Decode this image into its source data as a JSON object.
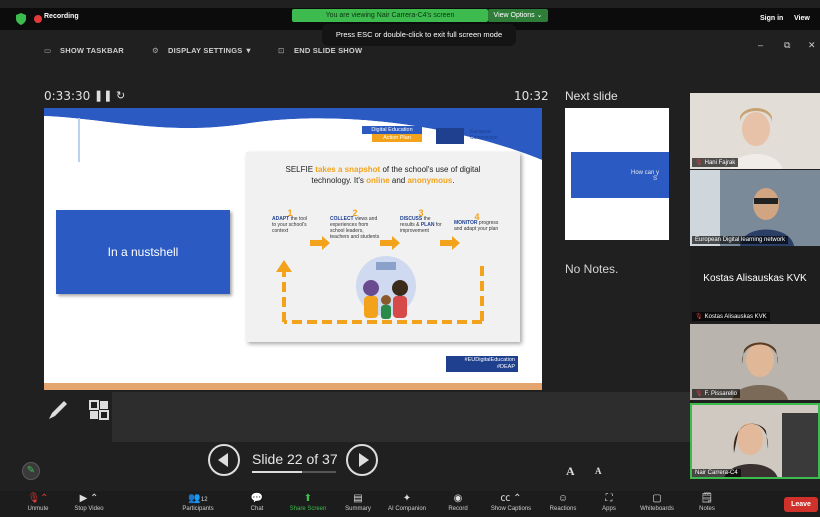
{
  "topbar": {
    "recording_label": "Recording",
    "viewing_text": "You are viewing Nair Carrera-C4's screen",
    "view_options": "View Options ⌄",
    "sign_in": "Sign in",
    "view": "View"
  },
  "esc_tip": "Press ESC or double-click to exit full screen mode",
  "presenter_toolbar": {
    "show_taskbar": "SHOW TASKBAR",
    "display_settings": "DISPLAY SETTINGS ▼",
    "end_slide_show": "END SLIDE SHOW"
  },
  "window_controls": {
    "minimize": "–",
    "restore": "⧉",
    "close": "✕"
  },
  "presenter": {
    "elapsed": "0:33:30",
    "pause_glyph": "❚❚",
    "reset_glyph": "↻",
    "clock": "10:32",
    "next_slide_label": "Next slide",
    "no_notes": "No Notes.",
    "slide_counter": "Slide 22 of 37",
    "progress": 0.5946,
    "font_up": "A",
    "font_down": "A"
  },
  "slide": {
    "box_title": "In a nustshell",
    "badge_line1": "Digital Education",
    "badge_line2": "Action Plan",
    "ec_line1": "European",
    "ec_line2": "Commission",
    "panel_pre": "SELFIE ",
    "panel_hl1": "takes a snapshot",
    "panel_mid": " of the school's use of digital technology. It's ",
    "panel_hl2": "online",
    "panel_and": " and ",
    "panel_hl3": "anonymous",
    "panel_end": ".",
    "steps": [
      {
        "num": "1",
        "bold": "ADAPT",
        "text": " the tool to your school's context"
      },
      {
        "num": "2",
        "bold": "COLLECT",
        "text": " views and experiences from school leaders, teachers and students"
      },
      {
        "num": "3",
        "bold": "DISCUSS",
        "text": " the results & "
      },
      {
        "num": "4",
        "bold": "MONITOR",
        "text": " progress and adapt your plan"
      }
    ],
    "step3_plan": "PLAN",
    "step3_end": " for improvement",
    "hashtag1": "#EUDigitalEducation",
    "hashtag2": "#DEAP"
  },
  "next_preview": {
    "text_a": "How can y",
    "text_b": "S"
  },
  "participants_tiles": [
    {
      "name": "Hani Fajrak",
      "muted": true,
      "video": true
    },
    {
      "name": "European Digital learning network",
      "muted": false,
      "video": true
    },
    {
      "name": "Kostas Alisauskas KVK",
      "muted": true,
      "video": false
    },
    {
      "name": "F. Pissarello",
      "muted": true,
      "video": true
    },
    {
      "name": "Nair Carrera-C4",
      "muted": false,
      "video": true,
      "speaking": true
    }
  ],
  "toolbar": {
    "unmute": "Unmute",
    "stop_video": "Stop Video",
    "participants": "Participants",
    "participants_count": "12",
    "chat": "Chat",
    "share_screen": "Share Screen",
    "summary": "Summary",
    "ai_companion": "AI Companion",
    "record": "Record",
    "show_captions": "Show Captions",
    "reactions": "Reactions",
    "apps": "Apps",
    "whiteboards": "Whiteboards",
    "notes": "Notes",
    "leave": "Leave"
  },
  "colors": {
    "accent_green": "#3dbb4f",
    "slide_blue": "#2a5ac2",
    "selfie_orange": "#f2a31b",
    "leave_red": "#d0322b"
  }
}
